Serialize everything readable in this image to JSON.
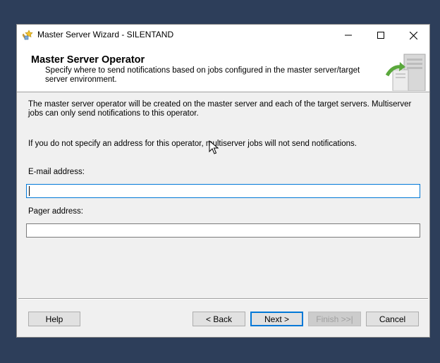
{
  "window": {
    "title": "Master Server Wizard - SILENTAND",
    "controls": {
      "minimize_icon": "minimize-icon",
      "maximize_icon": "maximize-icon",
      "close_icon": "close-icon"
    }
  },
  "header": {
    "title": "Master Server Operator",
    "subtitle": "Specify where to send notifications based on jobs configured in the master server/target server environment."
  },
  "body": {
    "paragraph1": "The master server operator will be created on the master server and each of the target servers. Multiserver jobs can only send notifications to this operator.",
    "paragraph2": "If you do not specify an address for this operator, multiserver jobs will not send notifications."
  },
  "fields": {
    "email_label": "E-mail address:",
    "email_value": "",
    "pager_label": "Pager address:",
    "pager_value": ""
  },
  "buttons": {
    "help": "Help",
    "back": "< Back",
    "next": "Next >",
    "finish": "Finish >>|",
    "cancel": "Cancel"
  },
  "colors": {
    "accent": "#0078d7",
    "desktop": "#2d3e5a",
    "dialog": "#f0f0f0"
  }
}
